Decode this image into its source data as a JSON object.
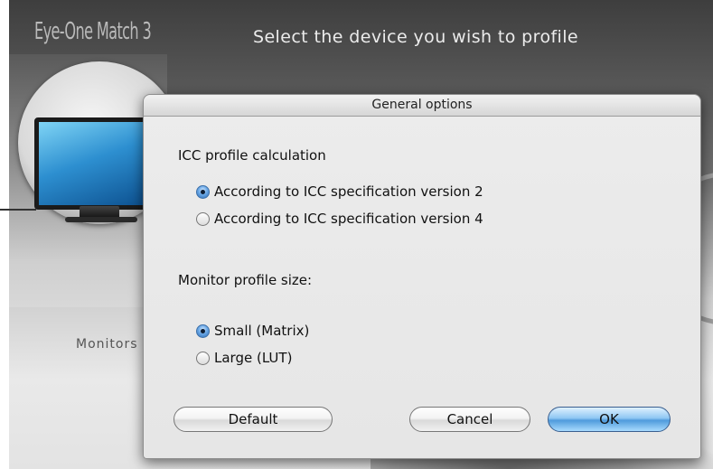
{
  "app": {
    "title": "Eye-One Match 3",
    "heading": "Select the device you wish to profile",
    "device_label": "Monitors"
  },
  "dialog": {
    "title": "General options",
    "icc_section": {
      "label": "ICC profile calculation",
      "options": [
        {
          "label": "According to ICC specification version 2",
          "selected": true
        },
        {
          "label": "According to ICC specification version 4",
          "selected": false
        }
      ]
    },
    "size_section": {
      "label": "Monitor profile size:",
      "options": [
        {
          "label": "Small (Matrix)",
          "selected": true
        },
        {
          "label": "Large (LUT)",
          "selected": false
        }
      ]
    },
    "buttons": {
      "default": "Default",
      "cancel": "Cancel",
      "ok": "OK"
    }
  },
  "colors": {
    "accent": "#4f9bdc",
    "monitor_screen": "#2d8fd0"
  }
}
